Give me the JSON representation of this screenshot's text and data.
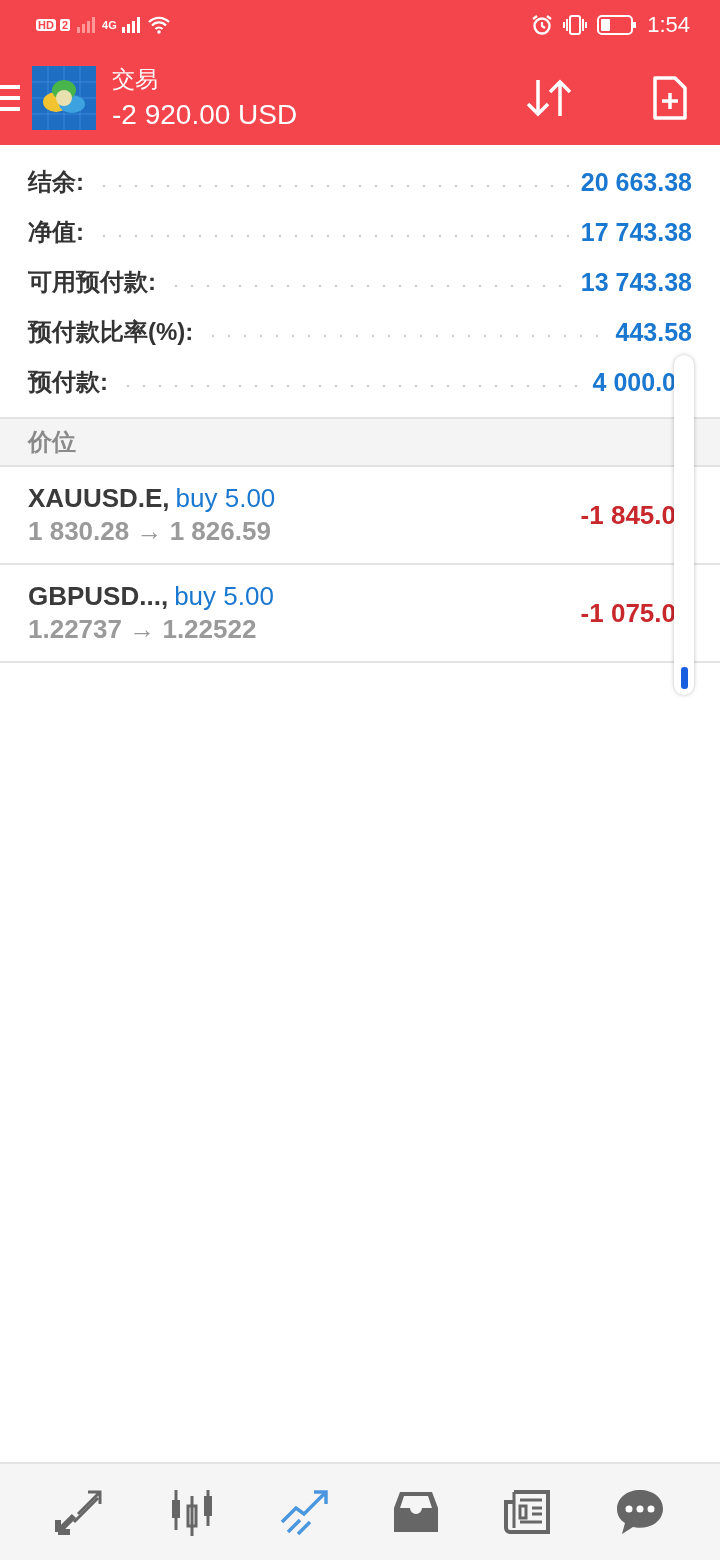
{
  "status_bar": {
    "network_label": "HD",
    "sim_label": "2",
    "network_type": "4G",
    "time": "1:54"
  },
  "toolbar": {
    "title": "交易",
    "subtitle": "-2 920.00 USD"
  },
  "summary": [
    {
      "label": "结余:",
      "value": "20 663.38"
    },
    {
      "label": "净值:",
      "value": "17 743.38"
    },
    {
      "label": "可用预付款:",
      "value": "13 743.38"
    },
    {
      "label": "预付款比率(%):",
      "value": "443.58"
    },
    {
      "label": "预付款:",
      "value": "4 000.0"
    }
  ],
  "section": {
    "title": "价位"
  },
  "positions": [
    {
      "symbol": "XAUUSD.E,",
      "action": "buy 5.00",
      "prices": "1 830.28 → 1 826.59",
      "profit": "-1 845.0"
    },
    {
      "symbol": "GBPUSD...,",
      "action": "buy 5.00",
      "prices": "1.22737 → 1.22522",
      "profit": "-1 075.0"
    }
  ],
  "bottom_nav": [
    {
      "kind": "quotes",
      "selected": false
    },
    {
      "kind": "chart",
      "selected": false
    },
    {
      "kind": "trade",
      "selected": true
    },
    {
      "kind": "history",
      "selected": false
    },
    {
      "kind": "news",
      "selected": false
    },
    {
      "kind": "chat",
      "selected": false
    }
  ]
}
